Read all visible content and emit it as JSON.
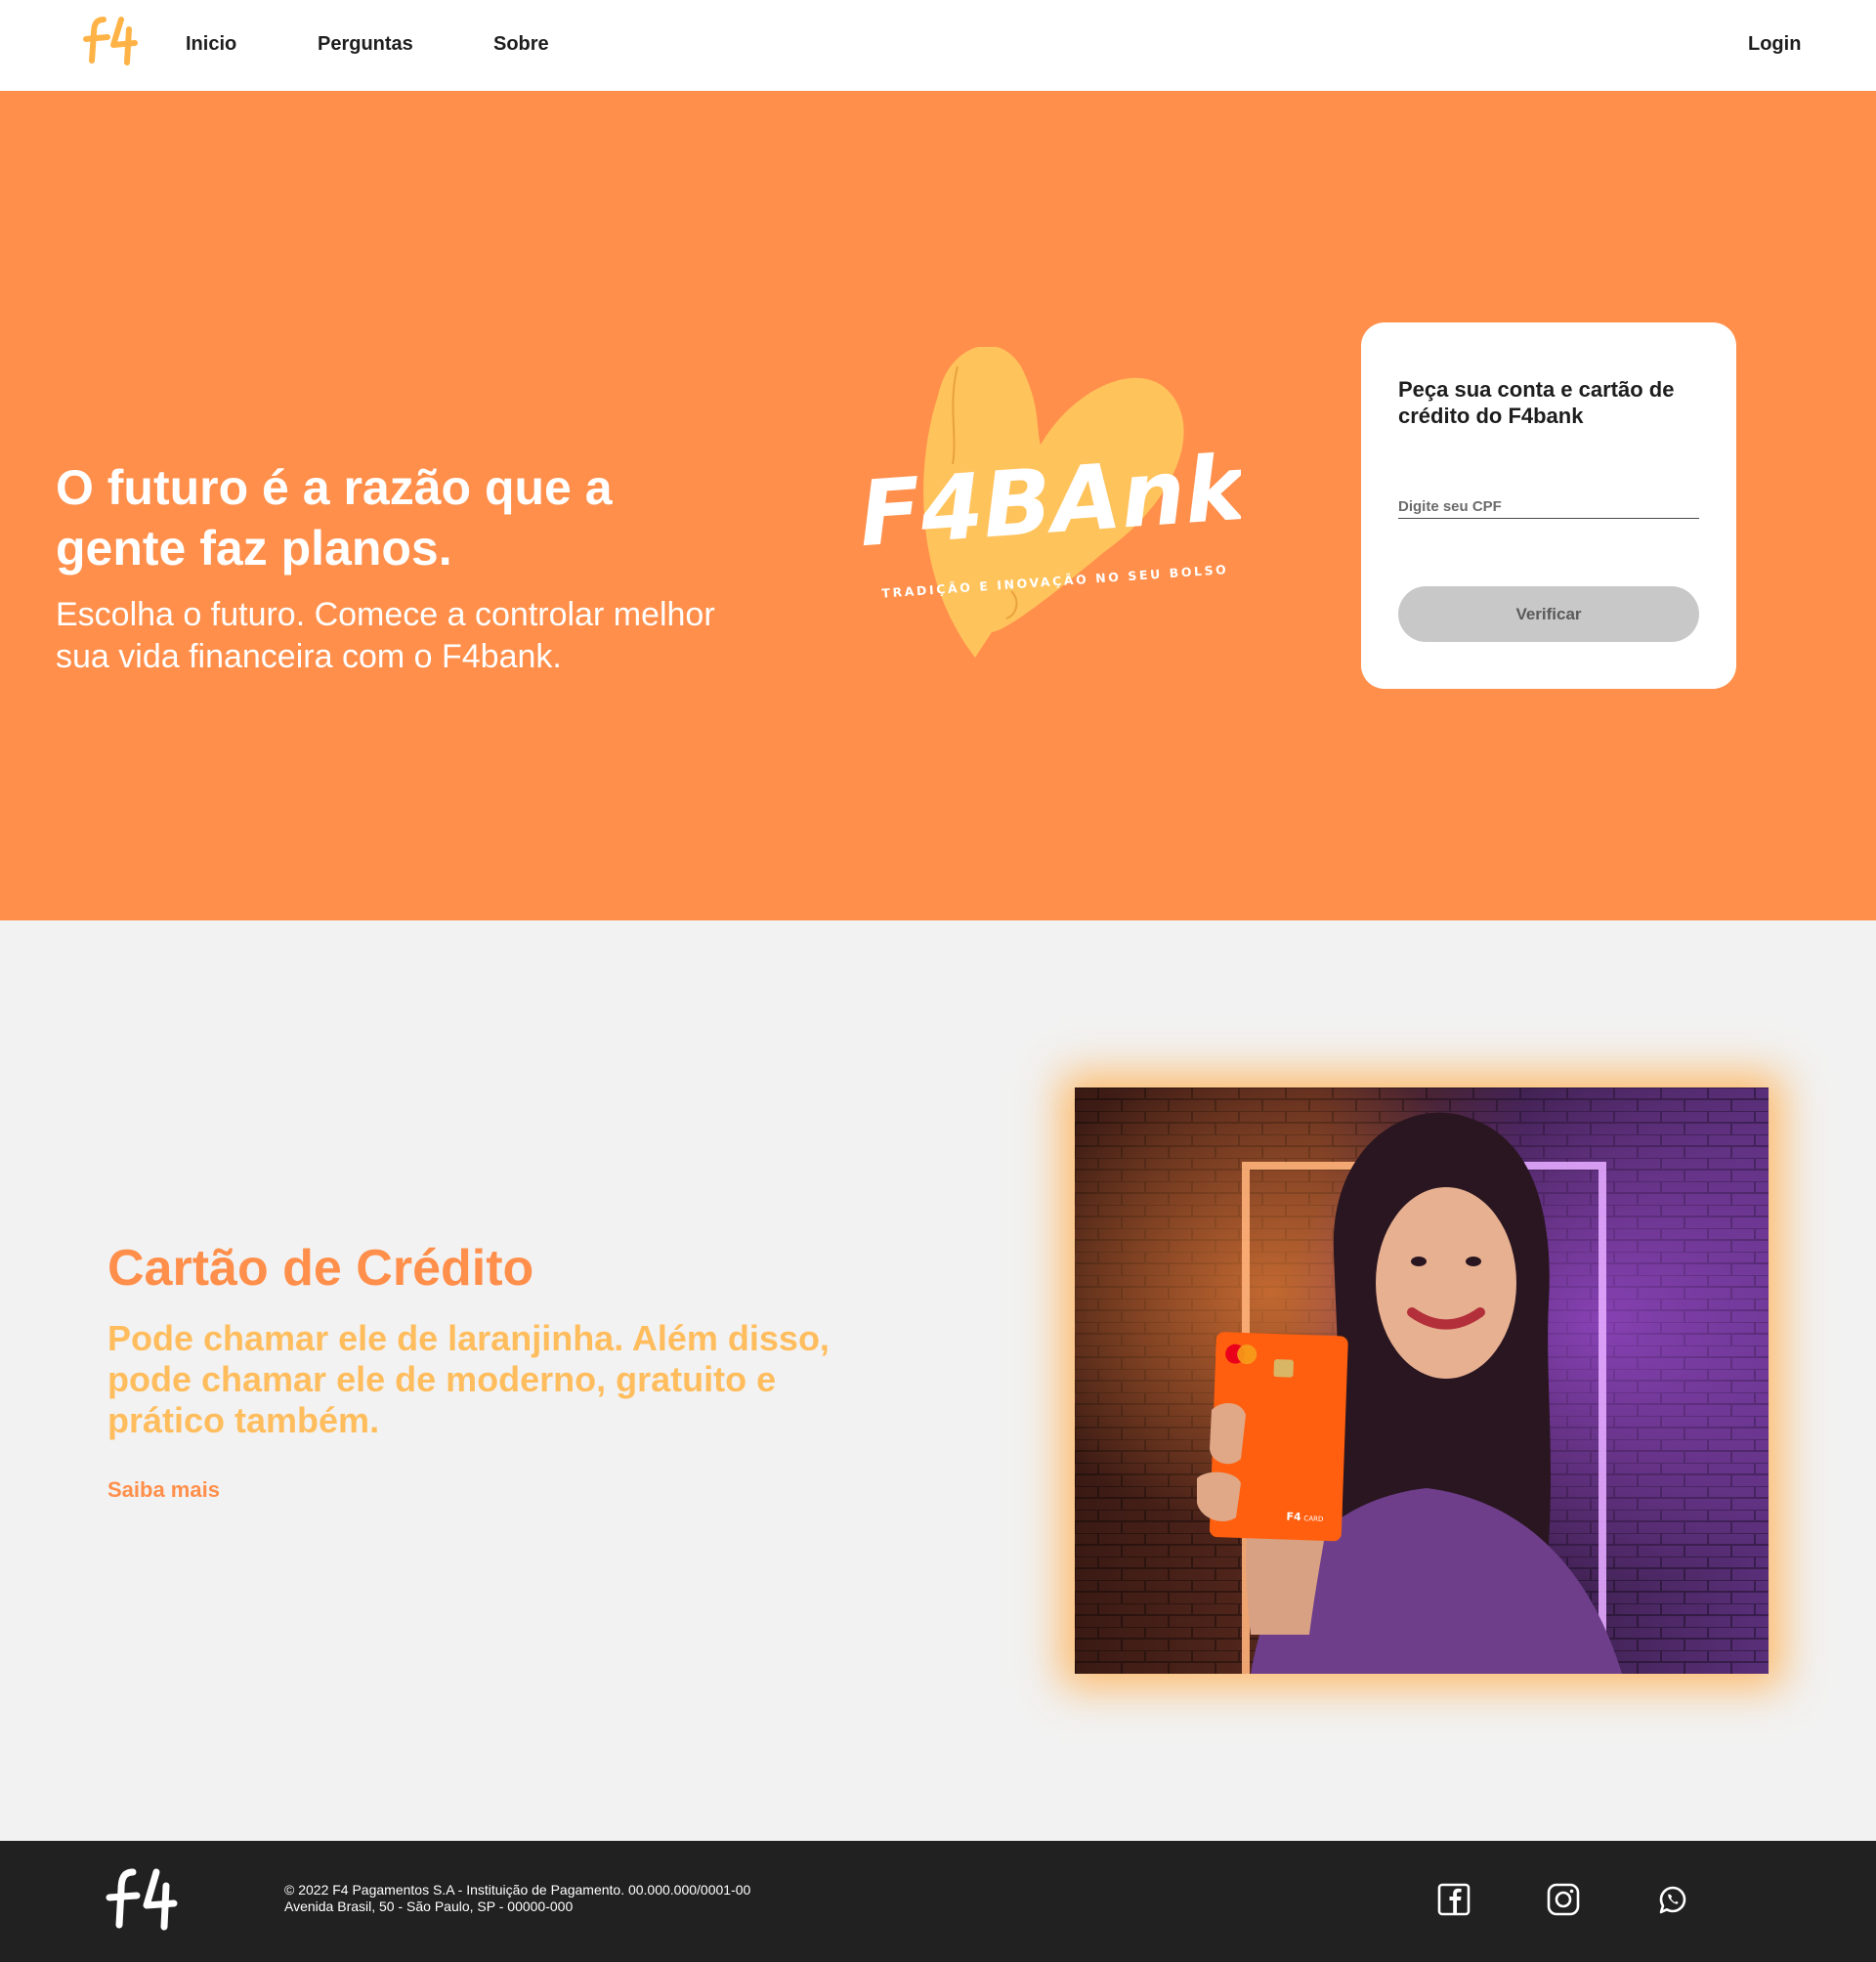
{
  "nav": {
    "logo_icon": "f4-logo-icon",
    "links": [
      "Inicio",
      "Perguntas",
      "Sobre"
    ],
    "login": "Login"
  },
  "hero": {
    "title": "O futuro é a razão que a gente faz planos.",
    "subtitle": "Escolha o futuro. Comece a controlar melhor sua vida financeira com o F4bank.",
    "logo_text": "F4BAnk",
    "logo_tagline": "TRADIÇÃO E INOVAÇÃO NO SEU BOLSO",
    "logo_icon": "heart-icon"
  },
  "signup": {
    "title": "Peça sua conta e cartão de crédito do F4bank",
    "cpf_placeholder": "Digite seu CPF",
    "cpf_value": "",
    "button": "Verificar"
  },
  "card_section": {
    "title": "Cartão de Crédito",
    "description": "Pode chamar ele de laranjinha. Além disso, pode chamar ele de moderno, gratuito e prático também.",
    "link": "Saiba mais",
    "card_brand": "F4",
    "card_label": "CARD"
  },
  "footer": {
    "line1": "© 2022 F4 Pagamentos S.A - Instituição de Pagamento. 00.000.000/0001-00",
    "line2": "Avenida Brasil, 50 - São Paulo, SP - 00000-000",
    "social_icons": [
      "facebook-icon",
      "instagram-icon",
      "whatsapp-icon"
    ]
  },
  "colors": {
    "brand_orange": "#ff8f4b",
    "light_orange": "#ffbd5e",
    "heart_yellow": "#ffc35c",
    "footer_bg": "#212121",
    "section_bg": "#f2f2f2",
    "button_disabled": "#c8c8c8"
  }
}
